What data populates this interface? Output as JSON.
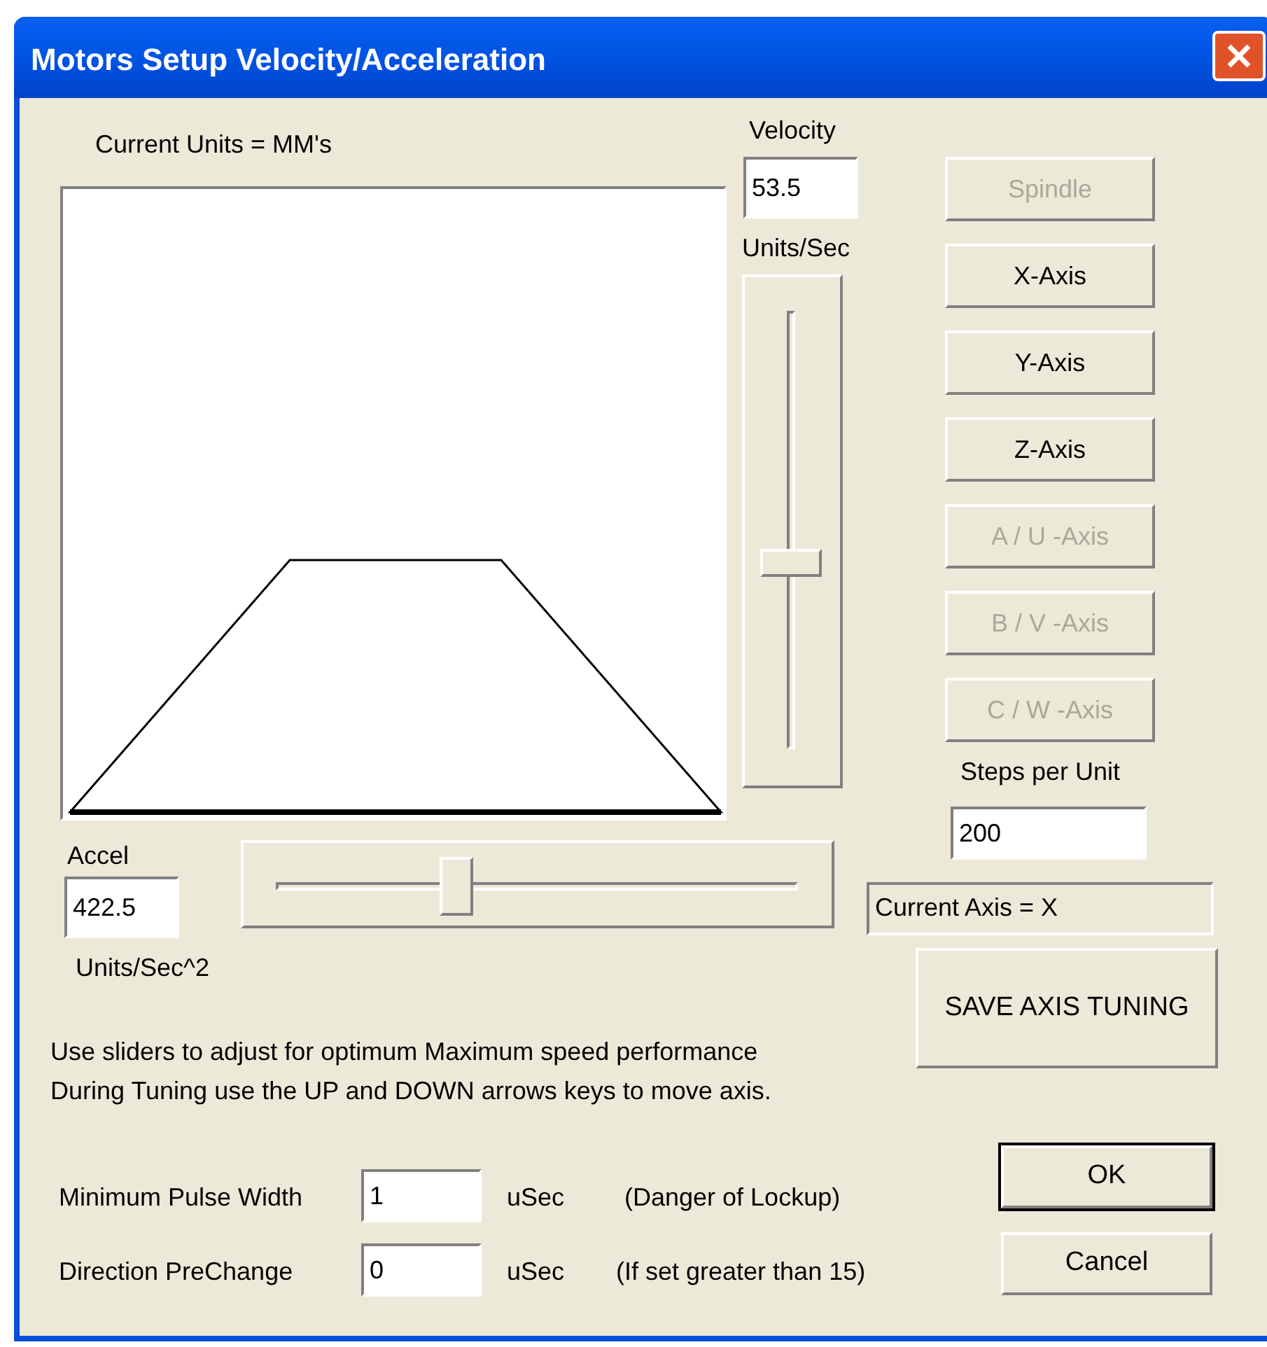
{
  "window": {
    "title": "Motors Setup Velocity/Acceleration"
  },
  "units_label": "Current Units =  MM's",
  "velocity": {
    "label": "Velocity",
    "value": "53.5",
    "units": "Units/Sec",
    "level": 0.43
  },
  "accel": {
    "label": "Accel",
    "value": "422.5",
    "units": "Units/Sec^2",
    "level": 0.34
  },
  "axis_buttons": [
    {
      "label": "Spindle",
      "disabled": true
    },
    {
      "label": "X-Axis",
      "disabled": false
    },
    {
      "label": "Y-Axis",
      "disabled": false
    },
    {
      "label": "Z-Axis",
      "disabled": false
    },
    {
      "label": "A / U -Axis",
      "disabled": true
    },
    {
      "label": "B / V -Axis",
      "disabled": true
    },
    {
      "label": "C / W -Axis",
      "disabled": true
    }
  ],
  "steps": {
    "label": "Steps per Unit",
    "value": "200"
  },
  "current_axis": "Current Axis = X",
  "save_button": "SAVE AXIS TUNING",
  "instructions": [
    "Use sliders to adjust for optimum Maximum speed performance",
    "During Tuning use the UP and DOWN arrows keys to move axis."
  ],
  "settings": [
    {
      "label": "Minimum Pulse Width",
      "value": "1",
      "unit": "uSec",
      "note": "(Danger of Lockup)"
    },
    {
      "label": "Direction PreChange",
      "value": "0",
      "unit": "uSec",
      "note": "(If set greater than 15)"
    }
  ],
  "buttons": [
    {
      "label": "OK",
      "default": true
    },
    {
      "label": "Cancel",
      "default": false
    }
  ]
}
